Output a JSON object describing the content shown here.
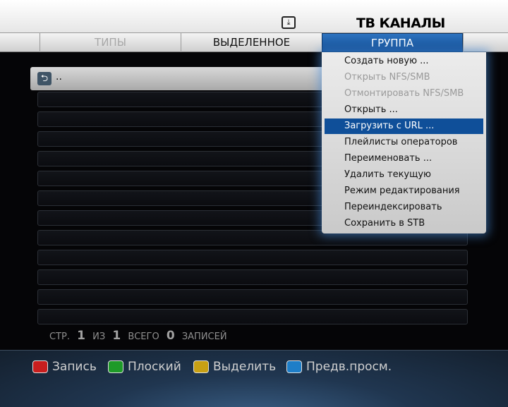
{
  "header": {
    "title": "ТВ КАНАЛЫ",
    "download_icon": "download-icon"
  },
  "tabs": [
    {
      "label": "ТИПЫ",
      "state": "dim"
    },
    {
      "label": "ВЫДЕЛЕННОЕ",
      "state": "normal"
    },
    {
      "label": "ГРУППА",
      "state": "active"
    }
  ],
  "list": {
    "back_label": "..",
    "back_icon": "back-arrow-icon"
  },
  "pager": {
    "page_word": "СТР.",
    "page": "1",
    "of_word": "ИЗ",
    "pages": "1",
    "total_word": "ВСЕГО",
    "total": "0",
    "records_word": "ЗАПИСЕЙ"
  },
  "menu": {
    "items": [
      {
        "label": "Создать новую ...",
        "state": "normal"
      },
      {
        "label": "Открыть NFS/SMB",
        "state": "disabled"
      },
      {
        "label": "Отмонтировать NFS/SMB",
        "state": "disabled"
      },
      {
        "label": "Открыть ...",
        "state": "normal"
      },
      {
        "label": "Загрузить с URL ...",
        "state": "selected"
      },
      {
        "label": "Плейлисты операторов",
        "state": "normal"
      },
      {
        "label": "Переименовать ...",
        "state": "normal"
      },
      {
        "label": "Удалить текущую",
        "state": "normal"
      },
      {
        "label": "Режим редактирования",
        "state": "normal"
      },
      {
        "label": "Переиндексировать",
        "state": "normal"
      },
      {
        "label": "Сохранить в STB",
        "state": "normal"
      }
    ]
  },
  "softkeys": [
    {
      "label": "Запись",
      "color": "#c81e1e"
    },
    {
      "label": "Плоский",
      "color": "#1e9a28"
    },
    {
      "label": "Выделить",
      "color": "#c8a014"
    },
    {
      "label": "Предв.просм.",
      "color": "#1e7ec8"
    }
  ],
  "colors": {
    "accent": "#0f4f99",
    "tab_active": "#1d5ea8"
  }
}
